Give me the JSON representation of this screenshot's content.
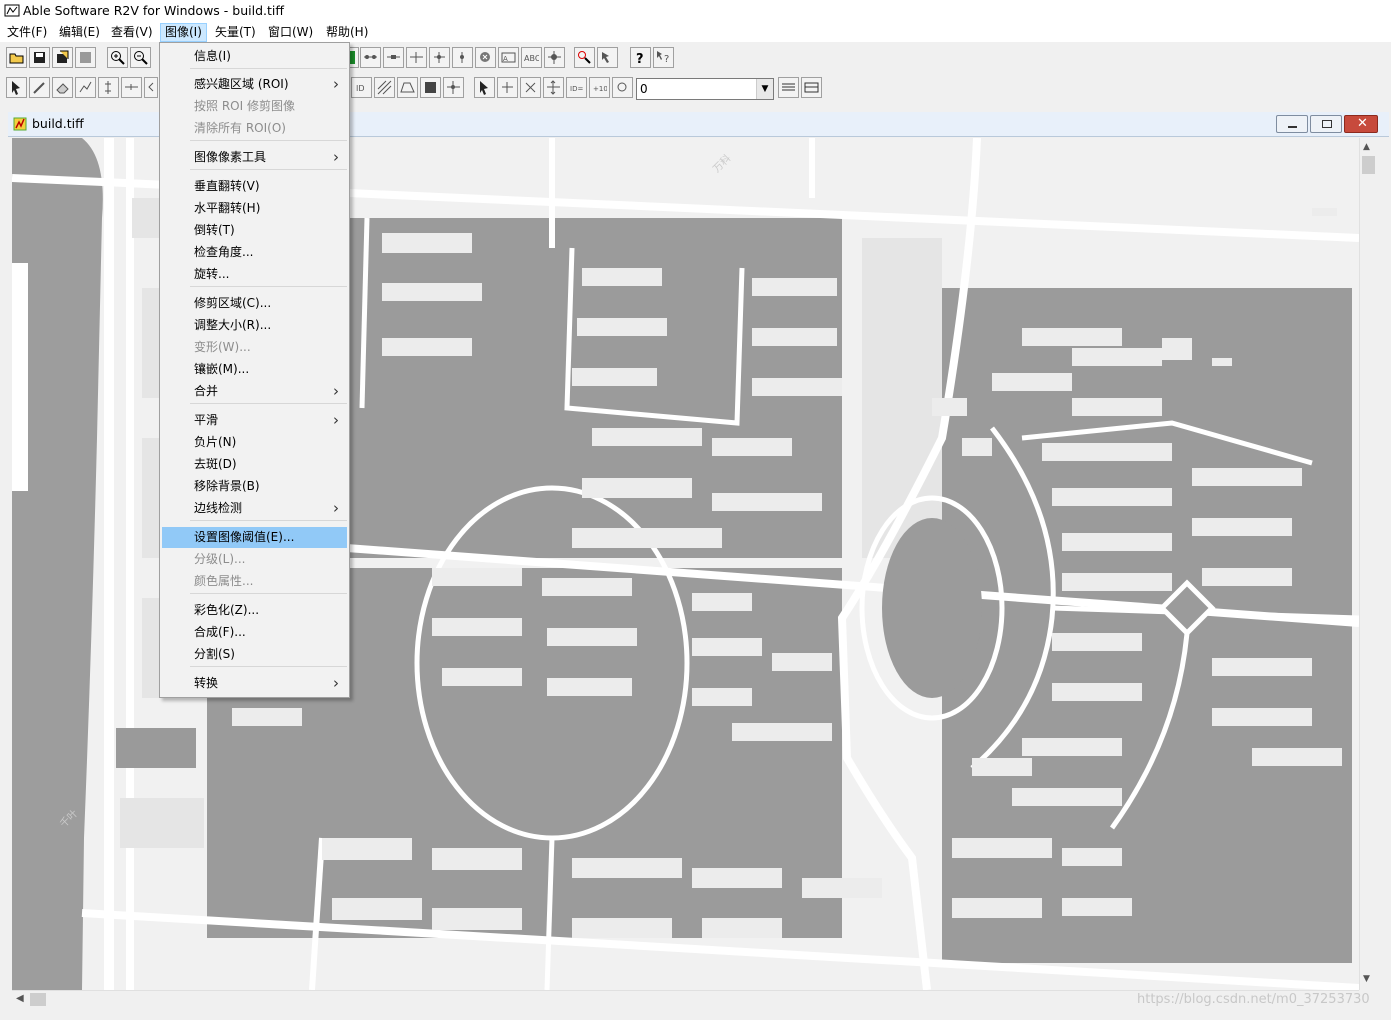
{
  "window": {
    "title": "Able Software R2V for Windows - build.tiff"
  },
  "menubar": {
    "items": [
      {
        "label": "文件(F)"
      },
      {
        "label": "编辑(E)"
      },
      {
        "label": "查看(V)"
      },
      {
        "label": "图像(I)"
      },
      {
        "label": "矢量(T)"
      },
      {
        "label": "窗口(W)"
      },
      {
        "label": "帮助(H)"
      }
    ],
    "active": "图像(I)"
  },
  "toolbar": {
    "value_combo": "0"
  },
  "child_window": {
    "title": "build.tiff"
  },
  "image_menu": {
    "items": [
      {
        "label": "信息(I)",
        "disabled": false,
        "submenu": false
      },
      {
        "label": "感兴趣区域 (ROI)",
        "disabled": false,
        "submenu": true
      },
      {
        "label": "按照 ROI 修剪图像",
        "disabled": true,
        "submenu": false
      },
      {
        "label": "清除所有 ROI(O)",
        "disabled": true,
        "submenu": false
      },
      {
        "label": "图像像素工具",
        "disabled": false,
        "submenu": true
      },
      {
        "label": "垂直翻转(V)",
        "disabled": false,
        "submenu": false
      },
      {
        "label": "水平翻转(H)",
        "disabled": false,
        "submenu": false
      },
      {
        "label": "倒转(T)",
        "disabled": false,
        "submenu": false
      },
      {
        "label": "检查角度...",
        "disabled": false,
        "submenu": false
      },
      {
        "label": "旋转...",
        "disabled": false,
        "submenu": false
      },
      {
        "label": "修剪区域(C)...",
        "disabled": false,
        "submenu": false
      },
      {
        "label": "调整大小(R)...",
        "disabled": false,
        "submenu": false
      },
      {
        "label": "变形(W)...",
        "disabled": true,
        "submenu": false
      },
      {
        "label": "镶嵌(M)...",
        "disabled": false,
        "submenu": false
      },
      {
        "label": "合并",
        "disabled": false,
        "submenu": true
      },
      {
        "label": "平滑",
        "disabled": false,
        "submenu": true
      },
      {
        "label": "负片(N)",
        "disabled": false,
        "submenu": false
      },
      {
        "label": "去斑(D)",
        "disabled": false,
        "submenu": false
      },
      {
        "label": "移除背景(B)",
        "disabled": false,
        "submenu": false
      },
      {
        "label": "边线检测",
        "disabled": false,
        "submenu": true
      },
      {
        "label": "设置图像阈值(E)...",
        "disabled": false,
        "submenu": false,
        "highlighted": true
      },
      {
        "label": "分级(L)...",
        "disabled": true,
        "submenu": false
      },
      {
        "label": "颜色属性...",
        "disabled": true,
        "submenu": false
      },
      {
        "label": "彩色化(Z)...",
        "disabled": false,
        "submenu": false
      },
      {
        "label": "合成(F)...",
        "disabled": false,
        "submenu": false
      },
      {
        "label": "分割(S)",
        "disabled": false,
        "submenu": false
      },
      {
        "label": "转换",
        "disabled": false,
        "submenu": true
      }
    ]
  },
  "watermark": "https://blog.csdn.net/m0_37253730",
  "colors": {
    "highlight": "#91c9f7",
    "building": "#9a9a9a",
    "road": "#ffffff",
    "ground": "#f1f1f1"
  }
}
